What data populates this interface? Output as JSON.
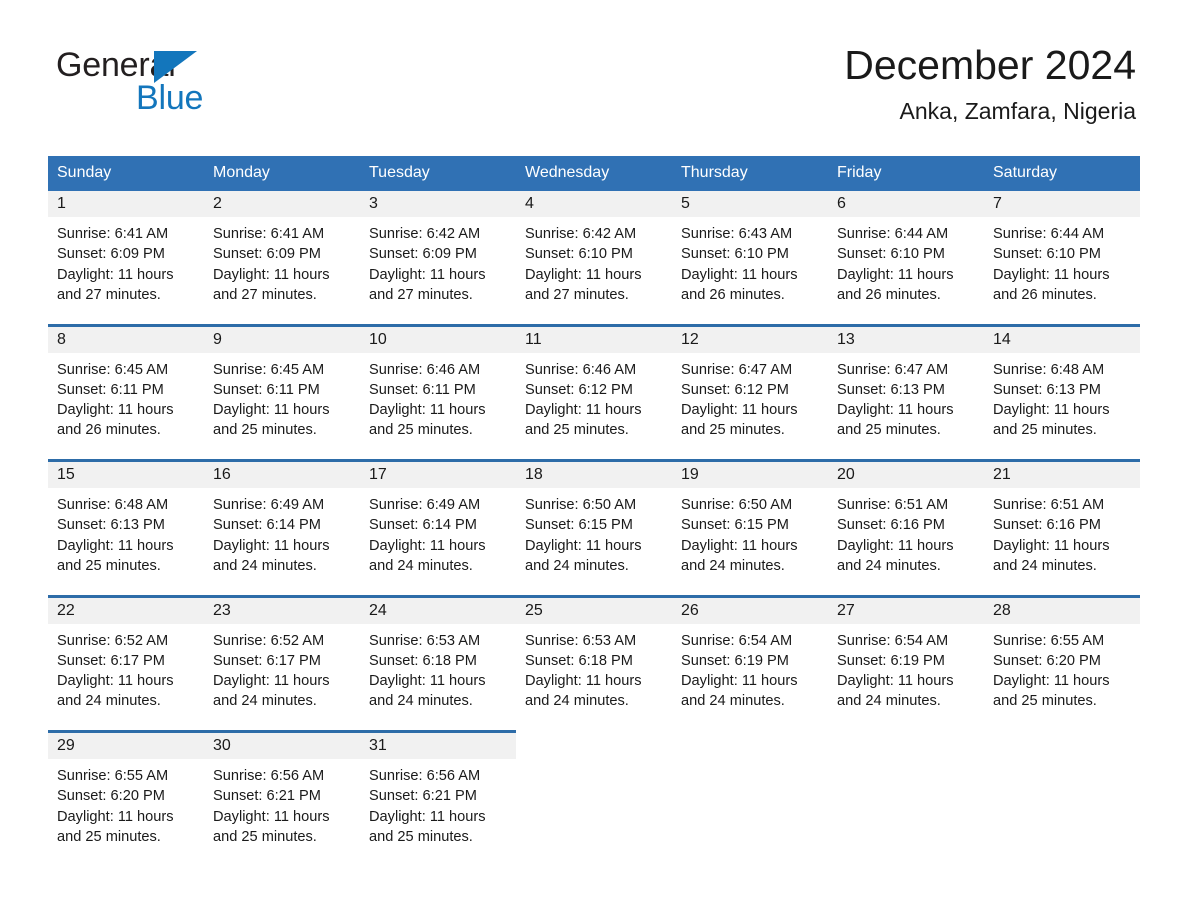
{
  "brand": {
    "word_top": "General",
    "word_bottom": "Blue",
    "triangle_color": "#1376bc"
  },
  "header": {
    "title": "December 2024",
    "subtitle": "Anka, Zamfara, Nigeria"
  },
  "theme": {
    "header_blue": "#3071b4",
    "row_border_blue": "#2d6ca8",
    "daynum_band": "#f1f1f1"
  },
  "weekday_headers": [
    "Sunday",
    "Monday",
    "Tuesday",
    "Wednesday",
    "Thursday",
    "Friday",
    "Saturday"
  ],
  "weeks": [
    {
      "days": [
        {
          "num": "1",
          "sunrise": "Sunrise: 6:41 AM",
          "sunset": "Sunset: 6:09 PM",
          "daylight_1": "Daylight: 11 hours",
          "daylight_2": "and 27 minutes."
        },
        {
          "num": "2",
          "sunrise": "Sunrise: 6:41 AM",
          "sunset": "Sunset: 6:09 PM",
          "daylight_1": "Daylight: 11 hours",
          "daylight_2": "and 27 minutes."
        },
        {
          "num": "3",
          "sunrise": "Sunrise: 6:42 AM",
          "sunset": "Sunset: 6:09 PM",
          "daylight_1": "Daylight: 11 hours",
          "daylight_2": "and 27 minutes."
        },
        {
          "num": "4",
          "sunrise": "Sunrise: 6:42 AM",
          "sunset": "Sunset: 6:10 PM",
          "daylight_1": "Daylight: 11 hours",
          "daylight_2": "and 27 minutes."
        },
        {
          "num": "5",
          "sunrise": "Sunrise: 6:43 AM",
          "sunset": "Sunset: 6:10 PM",
          "daylight_1": "Daylight: 11 hours",
          "daylight_2": "and 26 minutes."
        },
        {
          "num": "6",
          "sunrise": "Sunrise: 6:44 AM",
          "sunset": "Sunset: 6:10 PM",
          "daylight_1": "Daylight: 11 hours",
          "daylight_2": "and 26 minutes."
        },
        {
          "num": "7",
          "sunrise": "Sunrise: 6:44 AM",
          "sunset": "Sunset: 6:10 PM",
          "daylight_1": "Daylight: 11 hours",
          "daylight_2": "and 26 minutes."
        }
      ]
    },
    {
      "days": [
        {
          "num": "8",
          "sunrise": "Sunrise: 6:45 AM",
          "sunset": "Sunset: 6:11 PM",
          "daylight_1": "Daylight: 11 hours",
          "daylight_2": "and 26 minutes."
        },
        {
          "num": "9",
          "sunrise": "Sunrise: 6:45 AM",
          "sunset": "Sunset: 6:11 PM",
          "daylight_1": "Daylight: 11 hours",
          "daylight_2": "and 25 minutes."
        },
        {
          "num": "10",
          "sunrise": "Sunrise: 6:46 AM",
          "sunset": "Sunset: 6:11 PM",
          "daylight_1": "Daylight: 11 hours",
          "daylight_2": "and 25 minutes."
        },
        {
          "num": "11",
          "sunrise": "Sunrise: 6:46 AM",
          "sunset": "Sunset: 6:12 PM",
          "daylight_1": "Daylight: 11 hours",
          "daylight_2": "and 25 minutes."
        },
        {
          "num": "12",
          "sunrise": "Sunrise: 6:47 AM",
          "sunset": "Sunset: 6:12 PM",
          "daylight_1": "Daylight: 11 hours",
          "daylight_2": "and 25 minutes."
        },
        {
          "num": "13",
          "sunrise": "Sunrise: 6:47 AM",
          "sunset": "Sunset: 6:13 PM",
          "daylight_1": "Daylight: 11 hours",
          "daylight_2": "and 25 minutes."
        },
        {
          "num": "14",
          "sunrise": "Sunrise: 6:48 AM",
          "sunset": "Sunset: 6:13 PM",
          "daylight_1": "Daylight: 11 hours",
          "daylight_2": "and 25 minutes."
        }
      ]
    },
    {
      "days": [
        {
          "num": "15",
          "sunrise": "Sunrise: 6:48 AM",
          "sunset": "Sunset: 6:13 PM",
          "daylight_1": "Daylight: 11 hours",
          "daylight_2": "and 25 minutes."
        },
        {
          "num": "16",
          "sunrise": "Sunrise: 6:49 AM",
          "sunset": "Sunset: 6:14 PM",
          "daylight_1": "Daylight: 11 hours",
          "daylight_2": "and 24 minutes."
        },
        {
          "num": "17",
          "sunrise": "Sunrise: 6:49 AM",
          "sunset": "Sunset: 6:14 PM",
          "daylight_1": "Daylight: 11 hours",
          "daylight_2": "and 24 minutes."
        },
        {
          "num": "18",
          "sunrise": "Sunrise: 6:50 AM",
          "sunset": "Sunset: 6:15 PM",
          "daylight_1": "Daylight: 11 hours",
          "daylight_2": "and 24 minutes."
        },
        {
          "num": "19",
          "sunrise": "Sunrise: 6:50 AM",
          "sunset": "Sunset: 6:15 PM",
          "daylight_1": "Daylight: 11 hours",
          "daylight_2": "and 24 minutes."
        },
        {
          "num": "20",
          "sunrise": "Sunrise: 6:51 AM",
          "sunset": "Sunset: 6:16 PM",
          "daylight_1": "Daylight: 11 hours",
          "daylight_2": "and 24 minutes."
        },
        {
          "num": "21",
          "sunrise": "Sunrise: 6:51 AM",
          "sunset": "Sunset: 6:16 PM",
          "daylight_1": "Daylight: 11 hours",
          "daylight_2": "and 24 minutes."
        }
      ]
    },
    {
      "days": [
        {
          "num": "22",
          "sunrise": "Sunrise: 6:52 AM",
          "sunset": "Sunset: 6:17 PM",
          "daylight_1": "Daylight: 11 hours",
          "daylight_2": "and 24 minutes."
        },
        {
          "num": "23",
          "sunrise": "Sunrise: 6:52 AM",
          "sunset": "Sunset: 6:17 PM",
          "daylight_1": "Daylight: 11 hours",
          "daylight_2": "and 24 minutes."
        },
        {
          "num": "24",
          "sunrise": "Sunrise: 6:53 AM",
          "sunset": "Sunset: 6:18 PM",
          "daylight_1": "Daylight: 11 hours",
          "daylight_2": "and 24 minutes."
        },
        {
          "num": "25",
          "sunrise": "Sunrise: 6:53 AM",
          "sunset": "Sunset: 6:18 PM",
          "daylight_1": "Daylight: 11 hours",
          "daylight_2": "and 24 minutes."
        },
        {
          "num": "26",
          "sunrise": "Sunrise: 6:54 AM",
          "sunset": "Sunset: 6:19 PM",
          "daylight_1": "Daylight: 11 hours",
          "daylight_2": "and 24 minutes."
        },
        {
          "num": "27",
          "sunrise": "Sunrise: 6:54 AM",
          "sunset": "Sunset: 6:19 PM",
          "daylight_1": "Daylight: 11 hours",
          "daylight_2": "and 24 minutes."
        },
        {
          "num": "28",
          "sunrise": "Sunrise: 6:55 AM",
          "sunset": "Sunset: 6:20 PM",
          "daylight_1": "Daylight: 11 hours",
          "daylight_2": "and 25 minutes."
        }
      ]
    },
    {
      "days": [
        {
          "num": "29",
          "sunrise": "Sunrise: 6:55 AM",
          "sunset": "Sunset: 6:20 PM",
          "daylight_1": "Daylight: 11 hours",
          "daylight_2": "and 25 minutes."
        },
        {
          "num": "30",
          "sunrise": "Sunrise: 6:56 AM",
          "sunset": "Sunset: 6:21 PM",
          "daylight_1": "Daylight: 11 hours",
          "daylight_2": "and 25 minutes."
        },
        {
          "num": "31",
          "sunrise": "Sunrise: 6:56 AM",
          "sunset": "Sunset: 6:21 PM",
          "daylight_1": "Daylight: 11 hours",
          "daylight_2": "and 25 minutes."
        },
        {
          "num": "",
          "sunrise": "",
          "sunset": "",
          "daylight_1": "",
          "daylight_2": ""
        },
        {
          "num": "",
          "sunrise": "",
          "sunset": "",
          "daylight_1": "",
          "daylight_2": ""
        },
        {
          "num": "",
          "sunrise": "",
          "sunset": "",
          "daylight_1": "",
          "daylight_2": ""
        },
        {
          "num": "",
          "sunrise": "",
          "sunset": "",
          "daylight_1": "",
          "daylight_2": ""
        }
      ]
    }
  ]
}
